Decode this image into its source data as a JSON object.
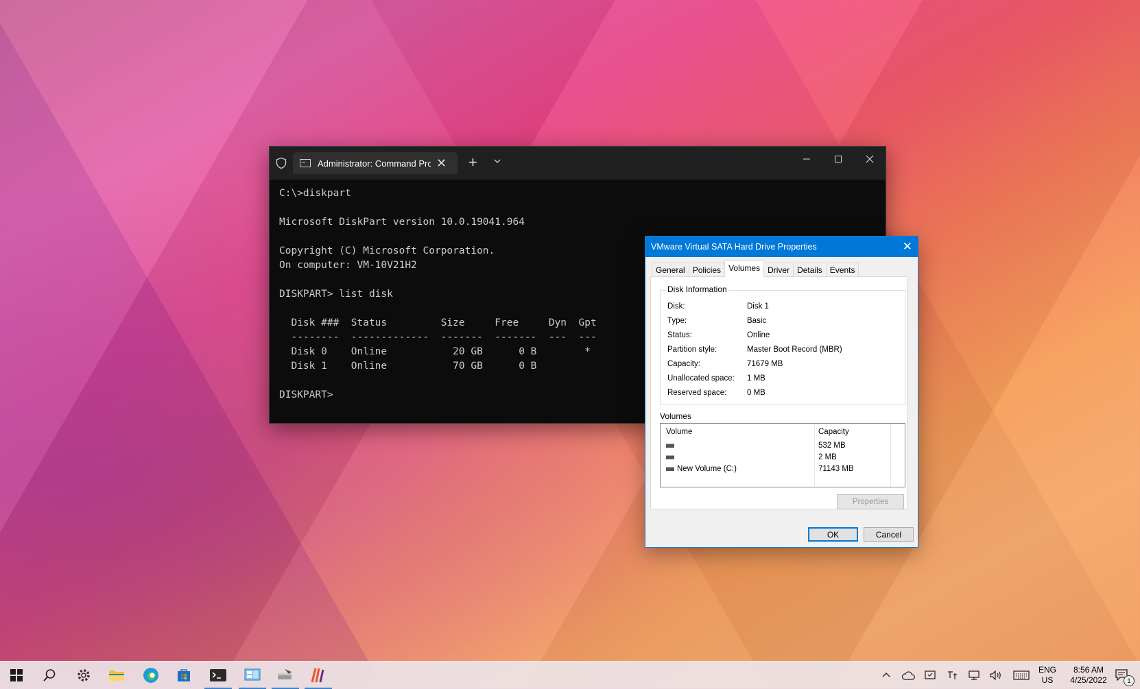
{
  "terminal": {
    "tab_title": "Administrator: Command Pror",
    "lines": [
      "C:\\>diskpart",
      "",
      "Microsoft DiskPart version 10.0.19041.964",
      "",
      "Copyright (C) Microsoft Corporation.",
      "On computer: VM-10V21H2",
      "",
      "DISKPART> list disk",
      "",
      "  Disk ###  Status         Size     Free     Dyn  Gpt",
      "  --------  -------------  -------  -------  ---  ---",
      "  Disk 0    Online           20 GB      0 B        *",
      "  Disk 1    Online           70 GB      0 B",
      "",
      "DISKPART> "
    ]
  },
  "dialog": {
    "title": "VMware Virtual SATA Hard Drive Properties",
    "tabs": [
      "General",
      "Policies",
      "Volumes",
      "Driver",
      "Details",
      "Events"
    ],
    "active_tab": "Volumes",
    "disk_info": {
      "group_label": "Disk Information",
      "rows": [
        {
          "label": "Disk:",
          "value": "Disk 1"
        },
        {
          "label": "Type:",
          "value": "Basic"
        },
        {
          "label": "Status:",
          "value": "Online"
        },
        {
          "label": "Partition style:",
          "value": "Master Boot Record (MBR)"
        },
        {
          "label": "Capacity:",
          "value": "71679 MB"
        },
        {
          "label": "Unallocated space:",
          "value": "1 MB"
        },
        {
          "label": "Reserved space:",
          "value": "0 MB"
        }
      ]
    },
    "volumes": {
      "label": "Volumes",
      "col_volume": "Volume",
      "col_capacity": "Capacity",
      "rows": [
        {
          "name": "",
          "capacity": "532 MB"
        },
        {
          "name": "",
          "capacity": "2 MB"
        },
        {
          "name": "New Volume (C:)",
          "capacity": "71143 MB"
        }
      ]
    },
    "properties_button": "Properties",
    "ok_button": "OK",
    "cancel_button": "Cancel"
  },
  "taskbar": {
    "apps": [
      "start-icon",
      "search-icon",
      "settings-icon",
      "file-explorer-icon",
      "edge-icon",
      "store-icon",
      "terminal-icon",
      "control-panel-icon",
      "disk-tool-icon",
      "paint-app-icon"
    ],
    "language": "ENG",
    "region": "US",
    "time": "8:56 AM",
    "date": "4/25/2022",
    "notification_count": "1"
  }
}
